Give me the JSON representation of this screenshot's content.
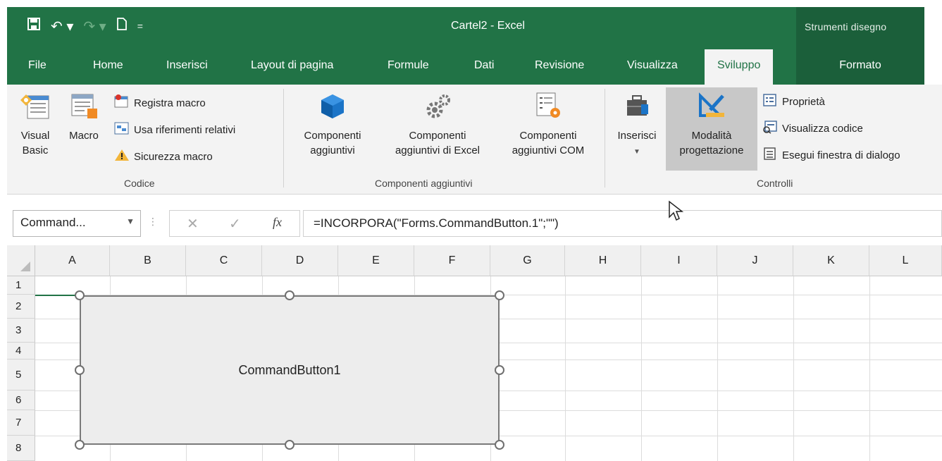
{
  "title": "Cartel2  -  Excel",
  "context_tools": "Strumenti disegno",
  "tabs": [
    {
      "label": "File"
    },
    {
      "label": "Home"
    },
    {
      "label": "Inserisci"
    },
    {
      "label": "Layout di pagina"
    },
    {
      "label": "Formule"
    },
    {
      "label": "Dati"
    },
    {
      "label": "Revisione"
    },
    {
      "label": "Visualizza"
    },
    {
      "label": "Sviluppo"
    },
    {
      "label": "Formato"
    }
  ],
  "ribbon": {
    "codice": {
      "visual_basic": [
        "Visual",
        "Basic"
      ],
      "macro": "Macro",
      "registra": "Registra macro",
      "usa_rif": "Usa riferimenti relativi",
      "sicurezza": "Sicurezza macro",
      "label": "Codice"
    },
    "componenti": {
      "agg": [
        "Componenti",
        "aggiuntivi"
      ],
      "excel": [
        "Componenti",
        "aggiuntivi di Excel"
      ],
      "com": [
        "Componenti",
        "aggiuntivi COM"
      ],
      "label": "Componenti aggiuntivi"
    },
    "controlli": {
      "inserisci": "Inserisci",
      "modalita": [
        "Modalità",
        "progettazione"
      ],
      "proprieta": "Proprietà",
      "visualizza": "Visualizza codice",
      "esegui": "Esegui finestra di dialogo",
      "label": "Controlli"
    }
  },
  "formula_bar": {
    "name_box": "Command...",
    "fx": "fx",
    "formula": "=INCORPORA(\"Forms.CommandButton.1\";\"\")"
  },
  "columns": [
    "A",
    "B",
    "C",
    "D",
    "E",
    "F",
    "G",
    "H",
    "I",
    "J",
    "K",
    "L"
  ],
  "rows": [
    "1",
    "2",
    "3",
    "4",
    "5",
    "6",
    "7",
    "8"
  ],
  "command_button": "CommandButton1",
  "colors": {
    "excel_green": "#217346",
    "dark_green": "#1b5f3a"
  }
}
